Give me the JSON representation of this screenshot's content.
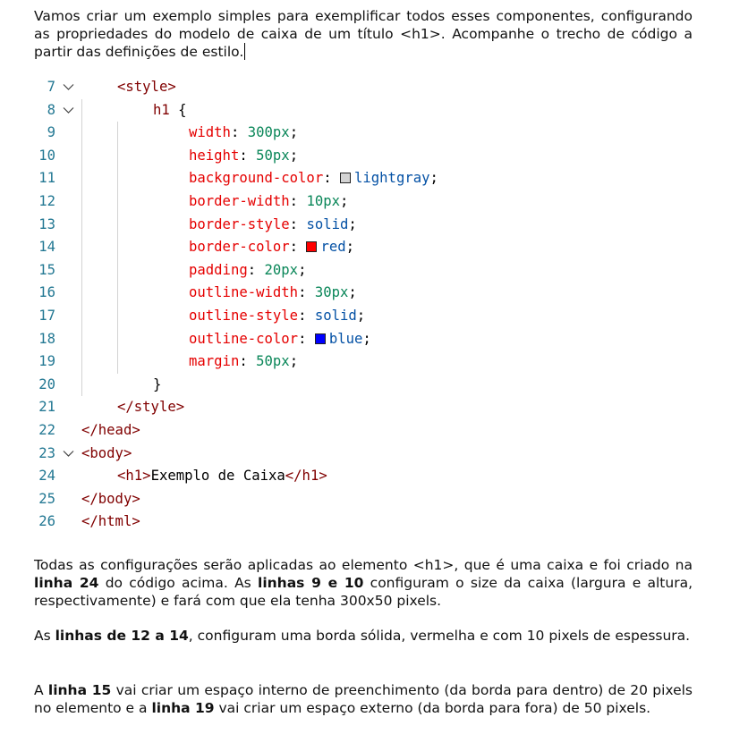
{
  "intro": {
    "text": "Vamos criar um exemplo simples para exemplificar todos esses componentes, configurando as propriedades do modelo de caixa de um título <h1>. Acompanhe o trecho de código a partir das definições de estilo."
  },
  "code": {
    "lines": [
      {
        "n": "7",
        "fold": true,
        "indent": 1,
        "tokens": [
          {
            "t": "<style>",
            "c": "tag"
          }
        ]
      },
      {
        "n": "8",
        "fold": true,
        "indent": 2,
        "tokens": [
          {
            "t": "h1",
            "c": "sel"
          },
          {
            "t": " {",
            "c": "plain"
          }
        ]
      },
      {
        "n": "9",
        "indent": 3,
        "tokens": [
          {
            "t": "width",
            "c": "prop"
          },
          {
            "t": ": ",
            "c": "plain"
          },
          {
            "t": "300px",
            "c": "num"
          },
          {
            "t": ";",
            "c": "plain"
          }
        ]
      },
      {
        "n": "10",
        "indent": 3,
        "tokens": [
          {
            "t": "height",
            "c": "prop"
          },
          {
            "t": ": ",
            "c": "plain"
          },
          {
            "t": "50px",
            "c": "num"
          },
          {
            "t": ";",
            "c": "plain"
          }
        ]
      },
      {
        "n": "11",
        "indent": 3,
        "tokens": [
          {
            "t": "background-color",
            "c": "prop"
          },
          {
            "t": ": ",
            "c": "plain"
          },
          {
            "swatch": "#d3d3d3"
          },
          {
            "t": "lightgray",
            "c": "val"
          },
          {
            "t": ";",
            "c": "plain"
          }
        ]
      },
      {
        "n": "12",
        "indent": 3,
        "tokens": [
          {
            "t": "border-width",
            "c": "prop"
          },
          {
            "t": ": ",
            "c": "plain"
          },
          {
            "t": "10px",
            "c": "num"
          },
          {
            "t": ";",
            "c": "plain"
          }
        ]
      },
      {
        "n": "13",
        "indent": 3,
        "tokens": [
          {
            "t": "border-style",
            "c": "prop"
          },
          {
            "t": ": ",
            "c": "plain"
          },
          {
            "t": "solid",
            "c": "val"
          },
          {
            "t": ";",
            "c": "plain"
          }
        ]
      },
      {
        "n": "14",
        "indent": 3,
        "tokens": [
          {
            "t": "border-color",
            "c": "prop"
          },
          {
            "t": ": ",
            "c": "plain"
          },
          {
            "swatch": "#ff0000"
          },
          {
            "t": "red",
            "c": "val"
          },
          {
            "t": ";",
            "c": "plain"
          }
        ]
      },
      {
        "n": "15",
        "indent": 3,
        "tokens": [
          {
            "t": "padding",
            "c": "prop"
          },
          {
            "t": ": ",
            "c": "plain"
          },
          {
            "t": "20px",
            "c": "num"
          },
          {
            "t": ";",
            "c": "plain"
          }
        ]
      },
      {
        "n": "16",
        "indent": 3,
        "tokens": [
          {
            "t": "outline-width",
            "c": "prop"
          },
          {
            "t": ": ",
            "c": "plain"
          },
          {
            "t": "30px",
            "c": "num"
          },
          {
            "t": ";",
            "c": "plain"
          }
        ]
      },
      {
        "n": "17",
        "indent": 3,
        "tokens": [
          {
            "t": "outline-style",
            "c": "prop"
          },
          {
            "t": ": ",
            "c": "plain"
          },
          {
            "t": "solid",
            "c": "val"
          },
          {
            "t": ";",
            "c": "plain"
          }
        ]
      },
      {
        "n": "18",
        "indent": 3,
        "tokens": [
          {
            "t": "outline-color",
            "c": "prop"
          },
          {
            "t": ": ",
            "c": "plain"
          },
          {
            "swatch": "#0000ff"
          },
          {
            "t": "blue",
            "c": "val"
          },
          {
            "t": ";",
            "c": "plain"
          }
        ]
      },
      {
        "n": "19",
        "indent": 3,
        "tokens": [
          {
            "t": "margin",
            "c": "prop"
          },
          {
            "t": ": ",
            "c": "plain"
          },
          {
            "t": "50px",
            "c": "num"
          },
          {
            "t": ";",
            "c": "plain"
          }
        ]
      },
      {
        "n": "20",
        "indent": 2,
        "tokens": [
          {
            "t": "}",
            "c": "plain"
          }
        ]
      },
      {
        "n": "21",
        "indent": 1,
        "tokens": [
          {
            "t": "</style>",
            "c": "tag"
          }
        ]
      },
      {
        "n": "22",
        "indent": 0,
        "tokens": [
          {
            "t": "</head>",
            "c": "tag"
          }
        ]
      },
      {
        "n": "23",
        "fold": true,
        "indent": 0,
        "tokens": [
          {
            "t": "<body>",
            "c": "tag"
          }
        ]
      },
      {
        "n": "24",
        "indent": 1,
        "tokens": [
          {
            "t": "<h1>",
            "c": "tag"
          },
          {
            "t": "Exemplo de Caixa",
            "c": "plain"
          },
          {
            "t": "</h1>",
            "c": "tag"
          }
        ]
      },
      {
        "n": "25",
        "indent": 0,
        "tokens": [
          {
            "t": "</body>",
            "c": "tag"
          }
        ]
      },
      {
        "n": "26",
        "indent": 0,
        "tokens": [
          {
            "t": "</html>",
            "c": "tag"
          }
        ]
      }
    ]
  },
  "para1": {
    "p1": "Todas as configurações serão aplicadas ao elemento <h1>, que é uma caixa e foi criado na ",
    "b1": "linha 24",
    "p2": " do código acima. As ",
    "b2": "linhas 9 e 10",
    "p3": " configuram o size da caixa (largura e altura, respectivamente) e fará com que ela tenha 300x50 pixels."
  },
  "para2": {
    "p1": "As ",
    "b1": "linhas de 12 a 14",
    "p2": ", configuram uma borda sólida, vermelha e com 10 pixels de espessura."
  },
  "para3": {
    "p1": "A ",
    "b1": "linha 15",
    "p2": " vai criar um espaço interno de preenchimento (da borda para dentro) de 20 pixels no elemento e a ",
    "b2": "linha 19",
    "p3": " vai criar um espaço externo (da borda para fora) de 50 pixels."
  }
}
